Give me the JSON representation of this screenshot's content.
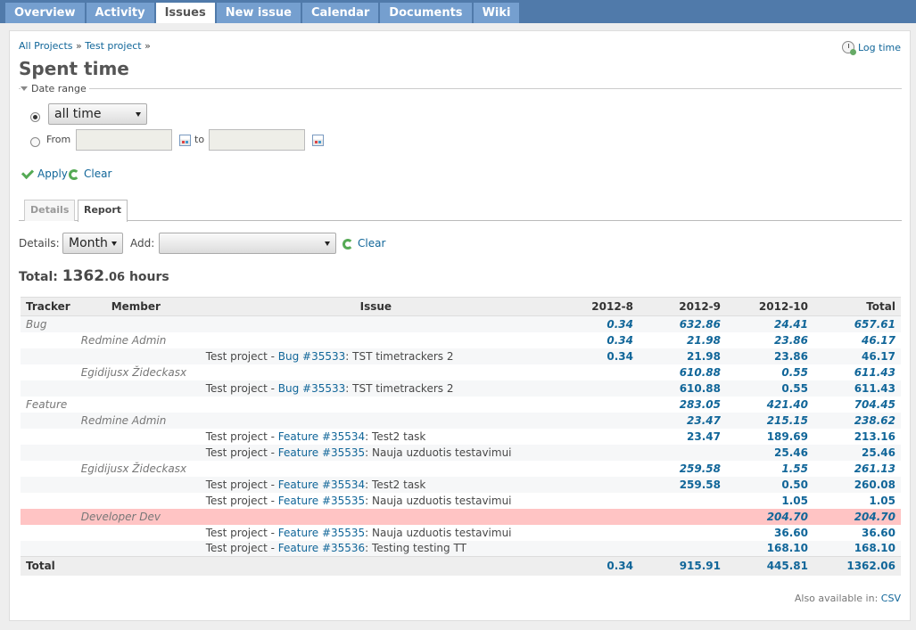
{
  "nav": {
    "tabs": [
      {
        "label": "Overview",
        "selected": false
      },
      {
        "label": "Activity",
        "selected": false
      },
      {
        "label": "Issues",
        "selected": true
      },
      {
        "label": "New issue",
        "selected": false
      },
      {
        "label": "Calendar",
        "selected": false
      },
      {
        "label": "Documents",
        "selected": false
      },
      {
        "label": "Wiki",
        "selected": false
      }
    ]
  },
  "breadcrumb": {
    "root": "All Projects",
    "sep": "»",
    "project": "Test project"
  },
  "page": {
    "title": "Spent time",
    "log_time": "Log time"
  },
  "filter": {
    "legend": "Date range",
    "period_value": "all time",
    "from_label": "From",
    "to_label": "to",
    "from_value": "",
    "to_value": "",
    "apply_label": "Apply",
    "clear_label": "Clear"
  },
  "subtabs": {
    "details": "Details",
    "report": "Report"
  },
  "report_controls": {
    "details_label": "Details:",
    "details_value": "Month",
    "add_label": "Add:",
    "add_value": "",
    "clear_label": "Clear"
  },
  "total": {
    "label": "Total:",
    "int": "1362",
    "dec": ".06",
    "unit": "hours"
  },
  "table": {
    "headers": [
      "Tracker",
      "Member",
      "Issue",
      "2012-8",
      "2012-9",
      "2012-10",
      "Total"
    ],
    "rows": [
      {
        "kind": "tracker",
        "tracker": "Bug",
        "member": "",
        "issue": null,
        "v": [
          "0.34",
          "632.86",
          "24.41",
          "657.61"
        ],
        "stripe": "odd"
      },
      {
        "kind": "member",
        "tracker": "",
        "member": "Redmine Admin",
        "issue": null,
        "v": [
          "0.34",
          "21.98",
          "23.86",
          "46.17"
        ],
        "stripe": "even"
      },
      {
        "kind": "issue",
        "tracker": "",
        "member": "",
        "issue": {
          "project": "Test project - ",
          "link": "Bug #35533",
          "subject": ": TST timetrackers 2"
        },
        "v": [
          "0.34",
          "21.98",
          "23.86",
          "46.17"
        ],
        "stripe": "odd"
      },
      {
        "kind": "member",
        "tracker": "",
        "member": "Egidijusx Žideckasx",
        "issue": null,
        "v": [
          "",
          "610.88",
          "0.55",
          "611.43"
        ],
        "stripe": "even"
      },
      {
        "kind": "issue",
        "tracker": "",
        "member": "",
        "issue": {
          "project": "Test project - ",
          "link": "Bug #35533",
          "subject": ": TST timetrackers 2"
        },
        "v": [
          "",
          "610.88",
          "0.55",
          "611.43"
        ],
        "stripe": "odd"
      },
      {
        "kind": "tracker",
        "tracker": "Feature",
        "member": "",
        "issue": null,
        "v": [
          "",
          "283.05",
          "421.40",
          "704.45"
        ],
        "stripe": "even"
      },
      {
        "kind": "member",
        "tracker": "",
        "member": "Redmine Admin",
        "issue": null,
        "v": [
          "",
          "23.47",
          "215.15",
          "238.62"
        ],
        "stripe": "odd"
      },
      {
        "kind": "issue",
        "tracker": "",
        "member": "",
        "issue": {
          "project": "Test project - ",
          "link": "Feature #35534",
          "subject": ": Test2 task"
        },
        "v": [
          "",
          "23.47",
          "189.69",
          "213.16"
        ],
        "stripe": "even"
      },
      {
        "kind": "issue",
        "tracker": "",
        "member": "",
        "issue": {
          "project": "Test project - ",
          "link": "Feature #35535",
          "subject": ": Nauja uzduotis testavimui"
        },
        "v": [
          "",
          "",
          "25.46",
          "25.46"
        ],
        "stripe": "odd"
      },
      {
        "kind": "member",
        "tracker": "",
        "member": "Egidijusx Žideckasx",
        "issue": null,
        "v": [
          "",
          "259.58",
          "1.55",
          "261.13"
        ],
        "stripe": "even"
      },
      {
        "kind": "issue",
        "tracker": "",
        "member": "",
        "issue": {
          "project": "Test project - ",
          "link": "Feature #35534",
          "subject": ": Test2 task"
        },
        "v": [
          "",
          "259.58",
          "0.50",
          "260.08"
        ],
        "stripe": "odd"
      },
      {
        "kind": "issue",
        "tracker": "",
        "member": "",
        "issue": {
          "project": "Test project - ",
          "link": "Feature #35535",
          "subject": ": Nauja uzduotis testavimui"
        },
        "v": [
          "",
          "",
          "1.05",
          "1.05"
        ],
        "stripe": "even"
      },
      {
        "kind": "member",
        "tracker": "",
        "member": "Developer Dev",
        "issue": null,
        "v": [
          "",
          "",
          "204.70",
          "204.70"
        ],
        "stripe": "hl"
      },
      {
        "kind": "issue",
        "tracker": "",
        "member": "",
        "issue": {
          "project": "Test project - ",
          "link": "Feature #35535",
          "subject": ": Nauja uzduotis testavimui"
        },
        "v": [
          "",
          "",
          "36.60",
          "36.60"
        ],
        "stripe": "even"
      },
      {
        "kind": "issue",
        "tracker": "",
        "member": "",
        "issue": {
          "project": "Test project - ",
          "link": "Feature #35536",
          "subject": ": Testing testing TT"
        },
        "v": [
          "",
          "",
          "168.10",
          "168.10"
        ],
        "stripe": "odd"
      }
    ],
    "total_row": {
      "label": "Total",
      "v": [
        "0.34",
        "915.91",
        "445.81",
        "1362.06"
      ]
    }
  },
  "also": {
    "label": "Also available in:",
    "csv": "CSV"
  },
  "colors": {
    "topbar": "#507aaa",
    "tab": "#759fcf",
    "link": "#1166aa",
    "highlight": "#ffc4c4"
  }
}
